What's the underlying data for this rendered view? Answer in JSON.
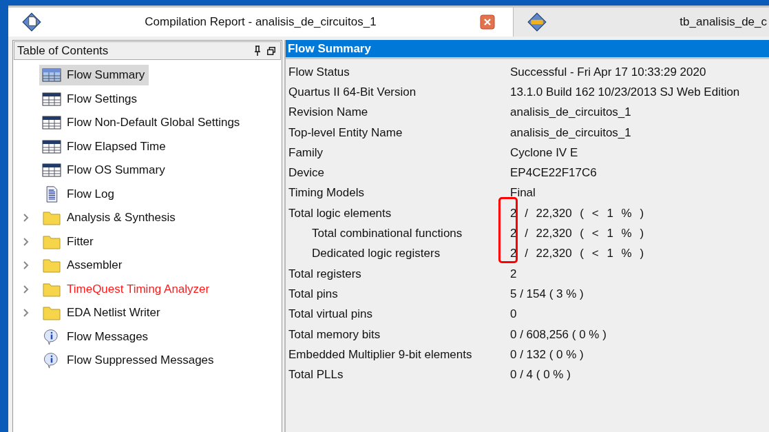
{
  "tabs": [
    {
      "label": "Compilation Report - analisis_de_circuitos_1",
      "kind": "report",
      "selected": true,
      "closable": true
    },
    {
      "label": "tb_analisis_de_c",
      "kind": "text",
      "selected": false,
      "closable": false
    }
  ],
  "toc": {
    "title": "Table of Contents",
    "items": [
      {
        "label": "Flow Summary",
        "kind": "table",
        "selected": true,
        "warning": false
      },
      {
        "label": "Flow Settings",
        "kind": "table",
        "selected": false,
        "warning": false
      },
      {
        "label": "Flow Non-Default Global Settings",
        "kind": "table",
        "selected": false,
        "warning": false
      },
      {
        "label": "Flow Elapsed Time",
        "kind": "table",
        "selected": false,
        "warning": false
      },
      {
        "label": "Flow OS Summary",
        "kind": "table",
        "selected": false,
        "warning": false
      },
      {
        "label": "Flow Log",
        "kind": "log",
        "selected": false,
        "warning": false
      },
      {
        "label": "Analysis & Synthesis",
        "kind": "folder",
        "expanded": false,
        "selected": false,
        "warning": false
      },
      {
        "label": "Fitter",
        "kind": "folder",
        "expanded": false,
        "selected": false,
        "warning": false
      },
      {
        "label": "Assembler",
        "kind": "folder",
        "expanded": false,
        "selected": false,
        "warning": false
      },
      {
        "label": "TimeQuest Timing Analyzer",
        "kind": "folder",
        "expanded": false,
        "selected": false,
        "warning": true
      },
      {
        "label": "EDA Netlist Writer",
        "kind": "folder",
        "expanded": false,
        "selected": false,
        "warning": false
      },
      {
        "label": "Flow Messages",
        "kind": "info",
        "selected": false,
        "warning": false
      },
      {
        "label": "Flow Suppressed Messages",
        "kind": "info",
        "selected": false,
        "warning": false
      }
    ]
  },
  "summary": {
    "title": "Flow Summary",
    "rows": [
      {
        "name": "Flow Status",
        "value": "Successful - Fri Apr 17 10:33:29 2020"
      },
      {
        "name": "Quartus II 64-Bit Version",
        "value": "13.1.0 Build 162 10/23/2013 SJ Web Edition"
      },
      {
        "name": "Revision Name",
        "value": "analisis_de_circuitos_1"
      },
      {
        "name": "Top-level Entity Name",
        "value": "analisis_de_circuitos_1"
      },
      {
        "name": "Family",
        "value": "Cyclone IV E"
      },
      {
        "name": "Device",
        "value": "EP4CE22F17C6"
      },
      {
        "name": "Timing Models",
        "value": "Final"
      },
      {
        "name": "Total logic elements",
        "value": "2 / 22,320 ( < 1 % )",
        "marked": true,
        "children": [
          {
            "name": "Total combinational functions",
            "value": "2 / 22,320 ( < 1 % )",
            "marked": true
          },
          {
            "name": "Dedicated logic registers",
            "value": "2 / 22,320 ( < 1 % )",
            "marked": true
          }
        ]
      },
      {
        "name": "Total registers",
        "value": "2"
      },
      {
        "name": "Total pins",
        "value": "5 / 154 ( 3 % )"
      },
      {
        "name": "Total virtual pins",
        "value": "0"
      },
      {
        "name": "Total memory bits",
        "value": "0 / 608,256 ( 0 % )"
      },
      {
        "name": "Embedded Multiplier 9-bit elements",
        "value": "0 / 132 ( 0 % )"
      },
      {
        "name": "Total PLLs",
        "value": "0 / 4 ( 0 % )"
      }
    ]
  }
}
